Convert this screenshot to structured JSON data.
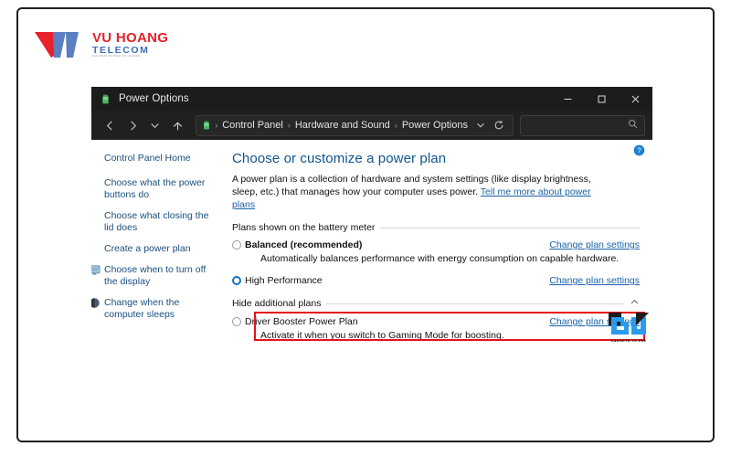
{
  "brand": {
    "name": "VU HOANG",
    "sub": "TELECOM",
    "tagline": "GIAI PHAP AN NINH TOI UU NHAT",
    "logo_icon": "vu-hoang-logo",
    "red": "#e8212b",
    "blue": "#3b6fb6"
  },
  "window": {
    "title": "Power Options",
    "title_icon": "battery-icon",
    "controls": {
      "minimize": "–",
      "maximize": "□",
      "close": "✕"
    }
  },
  "toolbar": {
    "back_icon": "arrow-left-icon",
    "forward_icon": "arrow-right-icon",
    "recent_icon": "chevron-down-icon",
    "up_icon": "arrow-up-icon",
    "address_icon": "battery-icon",
    "breadcrumbs": [
      "Control Panel",
      "Hardware and Sound",
      "Power Options"
    ],
    "separator": "›",
    "dropdown_icon": "chevron-down-icon",
    "refresh_icon": "refresh-icon",
    "search_icon": "search-icon",
    "search_value": "",
    "search_placeholder": ""
  },
  "help": {
    "icon": "help-circle-icon",
    "label": "?"
  },
  "sidebar": {
    "items": [
      {
        "label": "Control Panel Home",
        "icon": null
      },
      {
        "label": "Choose what the power buttons do",
        "icon": null
      },
      {
        "label": "Choose what closing the lid does",
        "icon": null
      },
      {
        "label": "Create a power plan",
        "icon": null
      },
      {
        "label": "Choose when to turn off the display",
        "icon": "display-icon"
      },
      {
        "label": "Change when the computer sleeps",
        "icon": "sleep-icon"
      }
    ]
  },
  "main": {
    "title": "Choose or customize a power plan",
    "description_part1": "A power plan is a collection of hardware and system settings (like display brightness, sleep, etc.) that manages how your computer uses power. ",
    "description_link": "Tell me more about power plans",
    "groups": [
      {
        "label": "Plans shown on the battery meter",
        "collapse_icon": null,
        "plans": [
          {
            "name": "Balanced (recommended)",
            "bold": true,
            "selected": false,
            "description": "Automatically balances performance with energy consumption on capable hardware.",
            "link": "Change plan settings",
            "highlighted": false
          },
          {
            "name": "High Performance",
            "bold": false,
            "selected": true,
            "description": "",
            "link": "Change plan settings",
            "highlighted": true
          }
        ]
      },
      {
        "label": "Hide additional plans",
        "collapse_icon": "chevron-up-icon",
        "plans": [
          {
            "name": "Driver Booster Power Plan",
            "bold": false,
            "selected": false,
            "description": "Activate it when you switch to Gaming Mode for boosting.",
            "link": "Change plan settings",
            "highlighted": false
          }
        ]
      }
    ]
  },
  "annotation": {
    "color": "#e5121a",
    "target": "High Performance"
  },
  "watermark": {
    "text": "GADGETS TO USE",
    "icon": "gadgets-to-use-logo",
    "blue": "#2a9bea"
  }
}
